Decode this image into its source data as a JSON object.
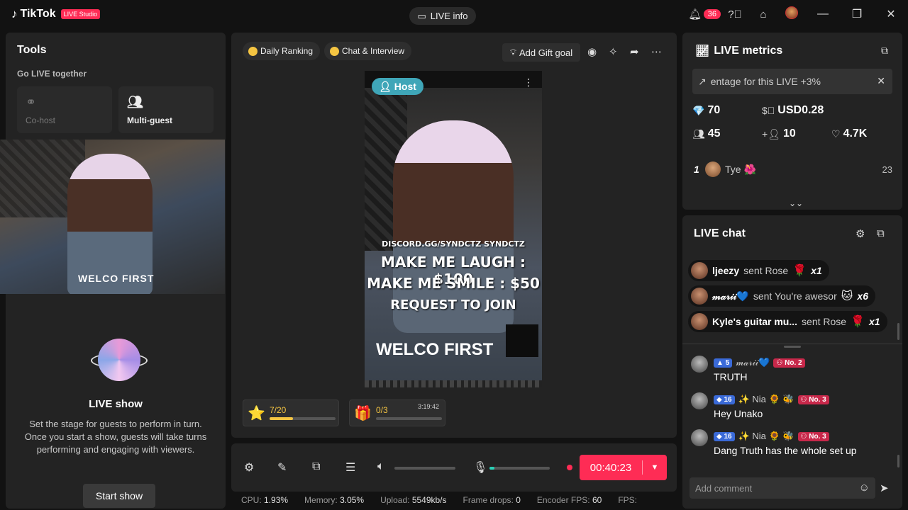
{
  "app": {
    "brand": "TikTok",
    "badge": "LIVE Studio"
  },
  "titlebar": {
    "live_info": "LIVE info",
    "notif_count": "36"
  },
  "tools": {
    "title": "Tools",
    "section": "Go LIVE together",
    "cohost": "Co-host",
    "multiguest": "Multi-guest",
    "cam_shirt": "WELCO FIRST",
    "show_title": "LIVE show",
    "show_desc": "Set the stage for guests to perform in turn. Once you start a show, guests will take turns performing and engaging with viewers.",
    "start_btn": "Start show"
  },
  "stage": {
    "daily_ranking": "Daily Ranking",
    "chat_interview": "Chat & Interview",
    "add_gift_goal": "Add Gift goal",
    "host_tag": "Host",
    "overlay_links": "DISCORD.GG/SYNDCTZ   SYNDCTZ",
    "overlay_line1": "MAKE ME LAUGH : $100",
    "overlay_line2": "MAKE ME SMILE : $50",
    "overlay_line3": "REQUEST TO JOIN",
    "shirt_text": "WELCO FIRST",
    "goal1": {
      "value": "7/20",
      "progress": 0.35
    },
    "goal2": {
      "value": "0/3",
      "timer": "3:19:42",
      "progress": 0.0
    }
  },
  "controls": {
    "timer": "00:40:23",
    "volume": 0.0,
    "mic_level": 0.08
  },
  "status": {
    "cpu_label": "CPU:",
    "cpu": "1.93%",
    "mem_label": "Memory:",
    "mem": "3.05%",
    "upload_label": "Upload:",
    "upload": "5549kb/s",
    "drops_label": "Frame drops:",
    "drops": "0",
    "enc_label": "Encoder FPS:",
    "enc": "60",
    "fps_label": "FPS:"
  },
  "metrics": {
    "title": "LIVE metrics",
    "banner": "entage for this LIVE +3%",
    "diamonds": "70",
    "usd": "USD0.28",
    "viewers": "45",
    "new_followers": "10",
    "likes": "4.7K",
    "rank": {
      "num": "1",
      "name": "Tye 🌺",
      "value": "23"
    }
  },
  "chat": {
    "title": "LIVE chat",
    "gifts": [
      {
        "name": "ljeezy",
        "sent": "sent Rose",
        "icon": "🌹",
        "count": "x1"
      },
      {
        "name": "𝓂𝒶𝓇𝒾𝒾💙",
        "sent": "sent You're awesor",
        "icon": "🐱",
        "count": "x6"
      },
      {
        "name": "Kyle's guitar mu...",
        "sent": "sent Rose",
        "icon": "🌹",
        "count": "x1"
      }
    ],
    "messages": [
      {
        "level": "5",
        "name": "𝓂𝒶𝓇𝒾𝒾💙",
        "rank": "No. 2",
        "text": "TRUTH"
      },
      {
        "level": "16",
        "name": "✨ Nia 🌻 🐝",
        "rank": "No. 3",
        "text": "Hey Unako"
      },
      {
        "level": "16",
        "name": "✨ Nia 🌻 🐝",
        "rank": "No. 3",
        "text": "Dang Truth has the whole set up"
      }
    ],
    "input_placeholder": "Add comment"
  }
}
